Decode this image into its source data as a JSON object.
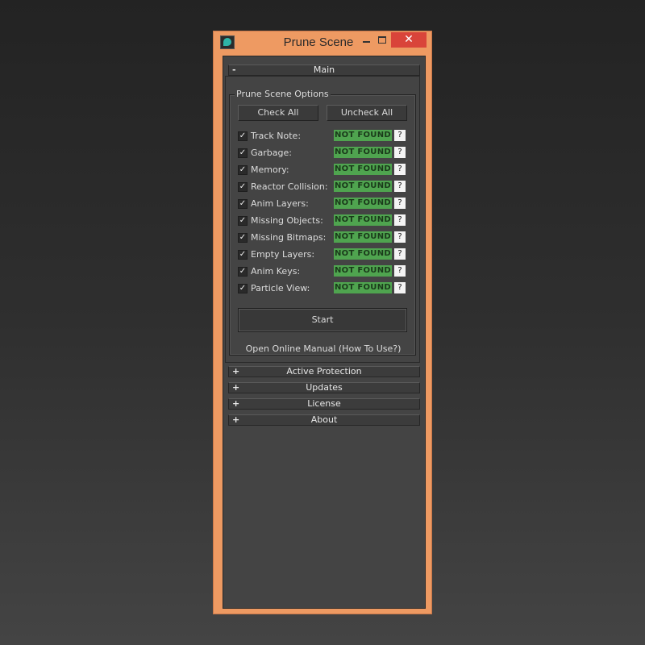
{
  "window": {
    "title": "Prune Scene",
    "close_glyph": "✕"
  },
  "main_rollout": {
    "sign": "-",
    "label": "Main"
  },
  "options_group": {
    "label": "Prune Scene Options",
    "check_all_label": "Check All",
    "uncheck_all_label": "Uncheck All",
    "items": [
      {
        "label": "Track Note:",
        "checked": true,
        "status": "NOT FOUND",
        "help": "?"
      },
      {
        "label": "Garbage:",
        "checked": true,
        "status": "NOT FOUND",
        "help": "?"
      },
      {
        "label": "Memory:",
        "checked": true,
        "status": "NOT FOUND",
        "help": "?"
      },
      {
        "label": "Reactor Collision:",
        "checked": true,
        "status": "NOT FOUND",
        "help": "?"
      },
      {
        "label": "Anim Layers:",
        "checked": true,
        "status": "NOT FOUND",
        "help": "?"
      },
      {
        "label": "Missing Objects:",
        "checked": true,
        "status": "NOT FOUND",
        "help": "?"
      },
      {
        "label": "Missing Bitmaps:",
        "checked": true,
        "status": "NOT FOUND",
        "help": "?"
      },
      {
        "label": "Empty Layers:",
        "checked": true,
        "status": "NOT FOUND",
        "help": "?"
      },
      {
        "label": "Anim Keys:",
        "checked": true,
        "status": "NOT FOUND",
        "help": "?"
      },
      {
        "label": "Particle View:",
        "checked": true,
        "status": "NOT FOUND",
        "help": "?"
      }
    ],
    "start_label": "Start",
    "manual_link": "Open Online Manual (How To Use?)"
  },
  "collapsed_rollouts": [
    {
      "sign": "+",
      "label": "Active Protection"
    },
    {
      "sign": "+",
      "label": "Updates"
    },
    {
      "sign": "+",
      "label": "License"
    },
    {
      "sign": "+",
      "label": "About"
    }
  ],
  "colors": {
    "window_frame": "#ee9a62",
    "panel": "#444444",
    "status_green": "#4fa44f",
    "close_red": "#d9443a"
  }
}
